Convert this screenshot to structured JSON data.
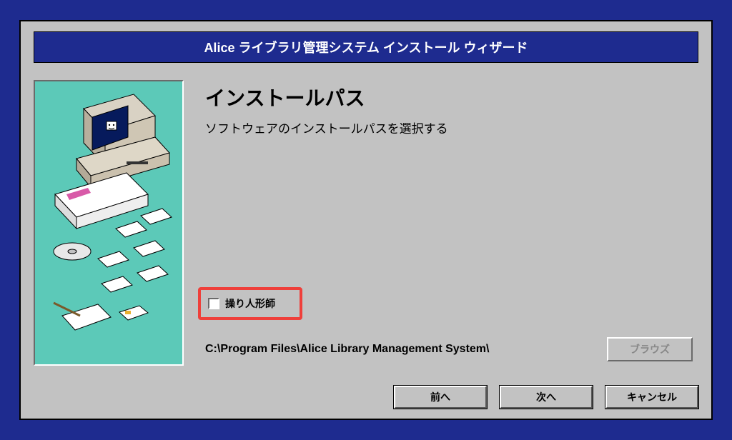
{
  "titlebar": {
    "text": "Alice ライブラリ管理システム インストール ウィザード"
  },
  "main": {
    "heading": "インストールパス",
    "subheading": "ソフトウェアのインストールパスを選択する",
    "checkbox_label": "操り人形師",
    "checkbox_checked": false,
    "install_path": "C:\\Program Files\\Alice Library Management System\\",
    "browse_label": "ブラウズ"
  },
  "buttons": {
    "back": "前へ",
    "next": "次へ",
    "cancel": "キャンセル"
  },
  "colors": {
    "window_bg": "#c2c2c2",
    "title_bg": "#1e2b8f",
    "illustration_bg": "#5cc9b8",
    "highlight": "#ef3f3a"
  }
}
